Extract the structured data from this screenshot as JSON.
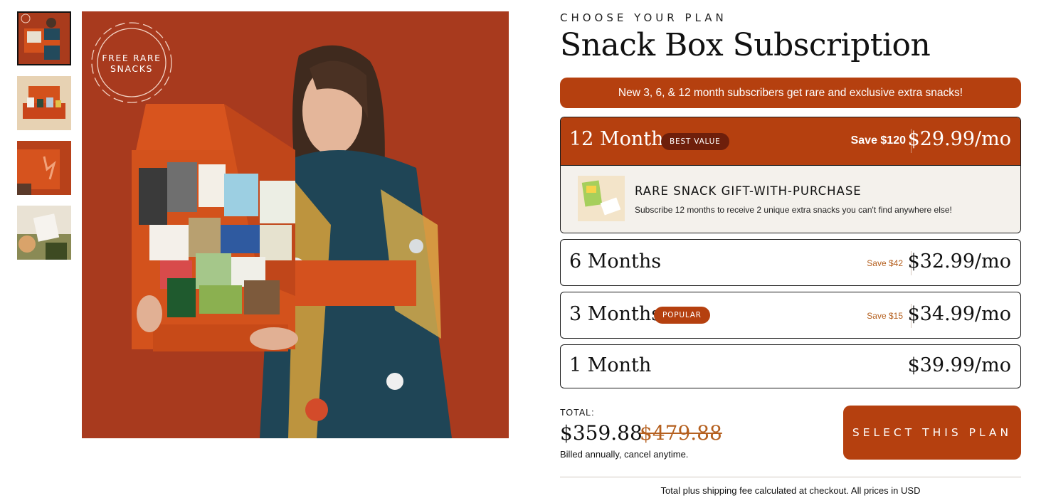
{
  "gallery": {
    "badge": "FREE RARE SNACKS",
    "thumbnails": [
      "box-with-model",
      "box-contents",
      "box-closeup",
      "lifestyle"
    ],
    "active_index": 0
  },
  "header": {
    "eyebrow": "CHOOSE YOUR PLAN",
    "title": "Snack Box Subscription"
  },
  "promo": "New 3, 6, & 12 month subscribers get rare and exclusive extra snacks!",
  "plans": [
    {
      "name": "12 Months",
      "badge": "BEST VALUE",
      "save": "Save $120",
      "price": "$29.99/mo",
      "selected": true
    },
    {
      "name": "6 Months",
      "badge": "",
      "save": "Save $42",
      "price": "$32.99/mo"
    },
    {
      "name": "3 Months",
      "badge": "POPULAR",
      "save": "Save $15",
      "price": "$34.99/mo"
    },
    {
      "name": "1 Month",
      "badge": "",
      "save": "",
      "price": "$39.99/mo"
    }
  ],
  "gift": {
    "title": "RARE SNACK GIFT-WITH-PURCHASE",
    "description": "Subscribe 12 months to receive 2 unique extra snacks you can't find anywhere else!"
  },
  "total": {
    "label": "TOTAL:",
    "price": "$359.88",
    "original_price": "$479.88",
    "billing_note": "Billed annually, cancel anytime."
  },
  "cta": "SELECT THIS PLAN",
  "footnote": "Total plus shipping fee calculated at checkout. All prices in USD",
  "colors": {
    "accent": "#b5400f",
    "accent_dark": "#6e1f0b",
    "save_text": "#b5601f",
    "gift_bg": "#f4f1ec"
  }
}
